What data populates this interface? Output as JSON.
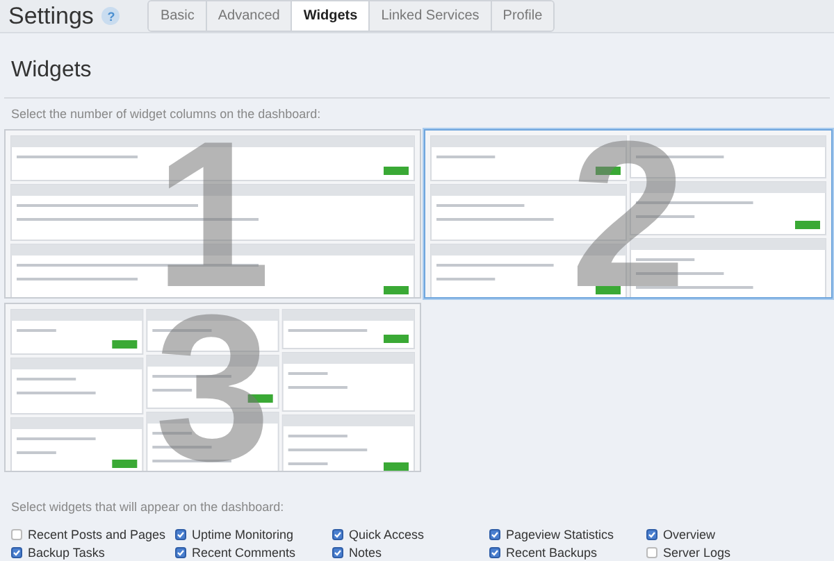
{
  "header": {
    "title": "Settings",
    "help": "?"
  },
  "tabs": [
    {
      "label": "Basic",
      "selected": false
    },
    {
      "label": "Advanced",
      "selected": false
    },
    {
      "label": "Widgets",
      "selected": true
    },
    {
      "label": "Linked Services",
      "selected": false
    },
    {
      "label": "Profile",
      "selected": false
    }
  ],
  "section_title": "Widgets",
  "columns_prompt": "Select the number of widget columns on the dashboard:",
  "layouts": [
    {
      "number": "1",
      "kind": "single",
      "selected": false
    },
    {
      "number": "2",
      "kind": "double",
      "selected": true
    },
    {
      "number": "3",
      "kind": "triple",
      "selected": false
    }
  ],
  "widgets_prompt": "Select widgets that will appear on the dashboard:",
  "widgets": [
    {
      "label": "Recent Posts and Pages",
      "checked": false
    },
    {
      "label": "Backup Tasks",
      "checked": true
    },
    {
      "label": "Uptime Monitoring",
      "checked": true
    },
    {
      "label": "Recent Comments",
      "checked": true
    },
    {
      "label": "Quick Access",
      "checked": true
    },
    {
      "label": "Notes",
      "checked": true
    },
    {
      "label": "Pageview Statistics",
      "checked": true
    },
    {
      "label": "Recent Backups",
      "checked": true
    },
    {
      "label": "Overview",
      "checked": true
    },
    {
      "label": "Server Logs",
      "checked": false
    }
  ]
}
